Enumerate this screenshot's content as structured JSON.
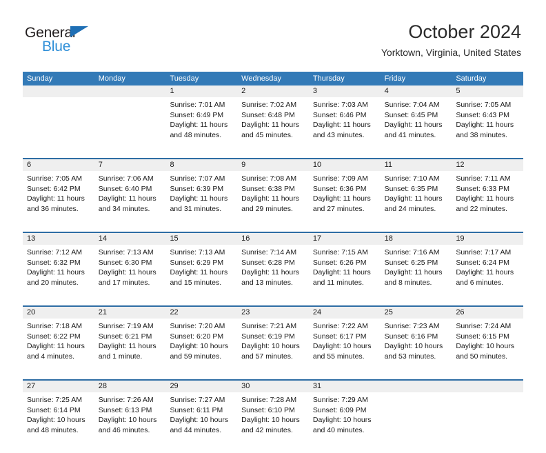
{
  "brand": {
    "name_part1": "General",
    "name_part2": "Blue",
    "triangle_color": "#1f6fb5",
    "blue_color": "#2f8fd8"
  },
  "header": {
    "title": "October 2024",
    "location": "Yorktown, Virginia, United States"
  },
  "colors": {
    "header_bar": "#337ab7",
    "week_divider": "#2e6da4",
    "daynum_band": "#efefef",
    "text": "#1a1a1a",
    "page_background": "#ffffff"
  },
  "calendar": {
    "weekday_headers": [
      "Sunday",
      "Monday",
      "Tuesday",
      "Wednesday",
      "Thursday",
      "Friday",
      "Saturday"
    ],
    "weeks": [
      [
        {
          "day": "",
          "lines": []
        },
        {
          "day": "",
          "lines": []
        },
        {
          "day": "1",
          "lines": [
            "Sunrise: 7:01 AM",
            "Sunset: 6:49 PM",
            "Daylight: 11 hours",
            "and 48 minutes."
          ]
        },
        {
          "day": "2",
          "lines": [
            "Sunrise: 7:02 AM",
            "Sunset: 6:48 PM",
            "Daylight: 11 hours",
            "and 45 minutes."
          ]
        },
        {
          "day": "3",
          "lines": [
            "Sunrise: 7:03 AM",
            "Sunset: 6:46 PM",
            "Daylight: 11 hours",
            "and 43 minutes."
          ]
        },
        {
          "day": "4",
          "lines": [
            "Sunrise: 7:04 AM",
            "Sunset: 6:45 PM",
            "Daylight: 11 hours",
            "and 41 minutes."
          ]
        },
        {
          "day": "5",
          "lines": [
            "Sunrise: 7:05 AM",
            "Sunset: 6:43 PM",
            "Daylight: 11 hours",
            "and 38 minutes."
          ]
        }
      ],
      [
        {
          "day": "6",
          "lines": [
            "Sunrise: 7:05 AM",
            "Sunset: 6:42 PM",
            "Daylight: 11 hours",
            "and 36 minutes."
          ]
        },
        {
          "day": "7",
          "lines": [
            "Sunrise: 7:06 AM",
            "Sunset: 6:40 PM",
            "Daylight: 11 hours",
            "and 34 minutes."
          ]
        },
        {
          "day": "8",
          "lines": [
            "Sunrise: 7:07 AM",
            "Sunset: 6:39 PM",
            "Daylight: 11 hours",
            "and 31 minutes."
          ]
        },
        {
          "day": "9",
          "lines": [
            "Sunrise: 7:08 AM",
            "Sunset: 6:38 PM",
            "Daylight: 11 hours",
            "and 29 minutes."
          ]
        },
        {
          "day": "10",
          "lines": [
            "Sunrise: 7:09 AM",
            "Sunset: 6:36 PM",
            "Daylight: 11 hours",
            "and 27 minutes."
          ]
        },
        {
          "day": "11",
          "lines": [
            "Sunrise: 7:10 AM",
            "Sunset: 6:35 PM",
            "Daylight: 11 hours",
            "and 24 minutes."
          ]
        },
        {
          "day": "12",
          "lines": [
            "Sunrise: 7:11 AM",
            "Sunset: 6:33 PM",
            "Daylight: 11 hours",
            "and 22 minutes."
          ]
        }
      ],
      [
        {
          "day": "13",
          "lines": [
            "Sunrise: 7:12 AM",
            "Sunset: 6:32 PM",
            "Daylight: 11 hours",
            "and 20 minutes."
          ]
        },
        {
          "day": "14",
          "lines": [
            "Sunrise: 7:13 AM",
            "Sunset: 6:30 PM",
            "Daylight: 11 hours",
            "and 17 minutes."
          ]
        },
        {
          "day": "15",
          "lines": [
            "Sunrise: 7:13 AM",
            "Sunset: 6:29 PM",
            "Daylight: 11 hours",
            "and 15 minutes."
          ]
        },
        {
          "day": "16",
          "lines": [
            "Sunrise: 7:14 AM",
            "Sunset: 6:28 PM",
            "Daylight: 11 hours",
            "and 13 minutes."
          ]
        },
        {
          "day": "17",
          "lines": [
            "Sunrise: 7:15 AM",
            "Sunset: 6:26 PM",
            "Daylight: 11 hours",
            "and 11 minutes."
          ]
        },
        {
          "day": "18",
          "lines": [
            "Sunrise: 7:16 AM",
            "Sunset: 6:25 PM",
            "Daylight: 11 hours",
            "and 8 minutes."
          ]
        },
        {
          "day": "19",
          "lines": [
            "Sunrise: 7:17 AM",
            "Sunset: 6:24 PM",
            "Daylight: 11 hours",
            "and 6 minutes."
          ]
        }
      ],
      [
        {
          "day": "20",
          "lines": [
            "Sunrise: 7:18 AM",
            "Sunset: 6:22 PM",
            "Daylight: 11 hours",
            "and 4 minutes."
          ]
        },
        {
          "day": "21",
          "lines": [
            "Sunrise: 7:19 AM",
            "Sunset: 6:21 PM",
            "Daylight: 11 hours",
            "and 1 minute."
          ]
        },
        {
          "day": "22",
          "lines": [
            "Sunrise: 7:20 AM",
            "Sunset: 6:20 PM",
            "Daylight: 10 hours",
            "and 59 minutes."
          ]
        },
        {
          "day": "23",
          "lines": [
            "Sunrise: 7:21 AM",
            "Sunset: 6:19 PM",
            "Daylight: 10 hours",
            "and 57 minutes."
          ]
        },
        {
          "day": "24",
          "lines": [
            "Sunrise: 7:22 AM",
            "Sunset: 6:17 PM",
            "Daylight: 10 hours",
            "and 55 minutes."
          ]
        },
        {
          "day": "25",
          "lines": [
            "Sunrise: 7:23 AM",
            "Sunset: 6:16 PM",
            "Daylight: 10 hours",
            "and 53 minutes."
          ]
        },
        {
          "day": "26",
          "lines": [
            "Sunrise: 7:24 AM",
            "Sunset: 6:15 PM",
            "Daylight: 10 hours",
            "and 50 minutes."
          ]
        }
      ],
      [
        {
          "day": "27",
          "lines": [
            "Sunrise: 7:25 AM",
            "Sunset: 6:14 PM",
            "Daylight: 10 hours",
            "and 48 minutes."
          ]
        },
        {
          "day": "28",
          "lines": [
            "Sunrise: 7:26 AM",
            "Sunset: 6:13 PM",
            "Daylight: 10 hours",
            "and 46 minutes."
          ]
        },
        {
          "day": "29",
          "lines": [
            "Sunrise: 7:27 AM",
            "Sunset: 6:11 PM",
            "Daylight: 10 hours",
            "and 44 minutes."
          ]
        },
        {
          "day": "30",
          "lines": [
            "Sunrise: 7:28 AM",
            "Sunset: 6:10 PM",
            "Daylight: 10 hours",
            "and 42 minutes."
          ]
        },
        {
          "day": "31",
          "lines": [
            "Sunrise: 7:29 AM",
            "Sunset: 6:09 PM",
            "Daylight: 10 hours",
            "and 40 minutes."
          ]
        },
        {
          "day": "",
          "lines": []
        },
        {
          "day": "",
          "lines": []
        }
      ]
    ]
  }
}
